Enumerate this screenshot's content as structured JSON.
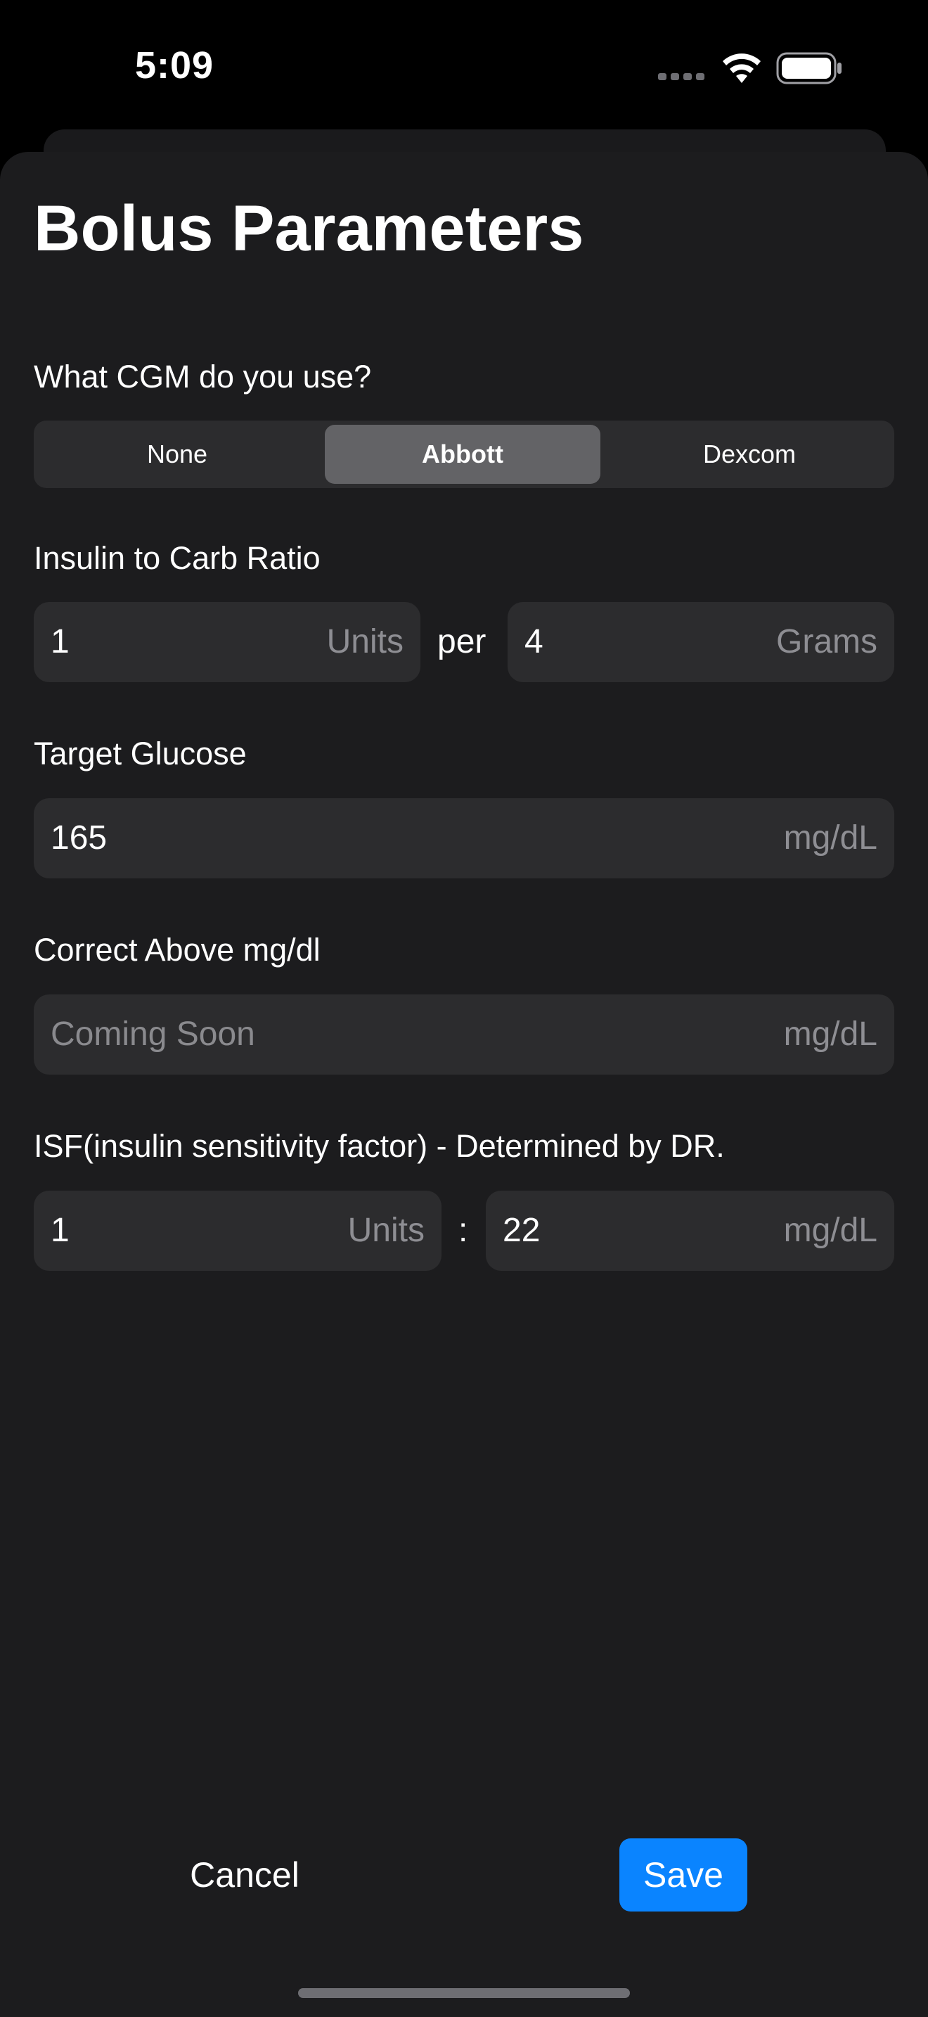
{
  "status_bar": {
    "time": "5:09",
    "icons": [
      "signal-dots-icon",
      "wifi-icon",
      "battery-icon"
    ]
  },
  "sheet": {
    "title": "Bolus Parameters"
  },
  "cgm": {
    "label": "What CGM do you use?",
    "options": [
      "None",
      "Abbott",
      "Dexcom"
    ],
    "selected": "Abbott"
  },
  "carb_ratio": {
    "label": "Insulin to Carb Ratio",
    "units_value": "1",
    "units_suffix": "Units",
    "separator": "per",
    "grams_value": "4",
    "grams_suffix": "Grams"
  },
  "target_glucose": {
    "label": "Target Glucose",
    "value": "165",
    "suffix": "mg/dL"
  },
  "correct_above": {
    "label": "Correct Above mg/dl",
    "placeholder": "Coming Soon",
    "suffix": "mg/dL"
  },
  "isf": {
    "label": "ISF(insulin sensitivity factor) - Determined by DR.",
    "units_value": "1",
    "units_suffix": "Units",
    "separator": ":",
    "mgdl_value": "22",
    "mgdl_suffix": "mg/dL"
  },
  "actions": {
    "cancel_label": "Cancel",
    "save_label": "Save"
  },
  "colors": {
    "background": "#000000",
    "sheet": "#1c1c1e",
    "field": "#2c2c2e",
    "segment_active": "#636366",
    "accent": "#0a84ff",
    "secondary_text": "#8e8e93"
  }
}
